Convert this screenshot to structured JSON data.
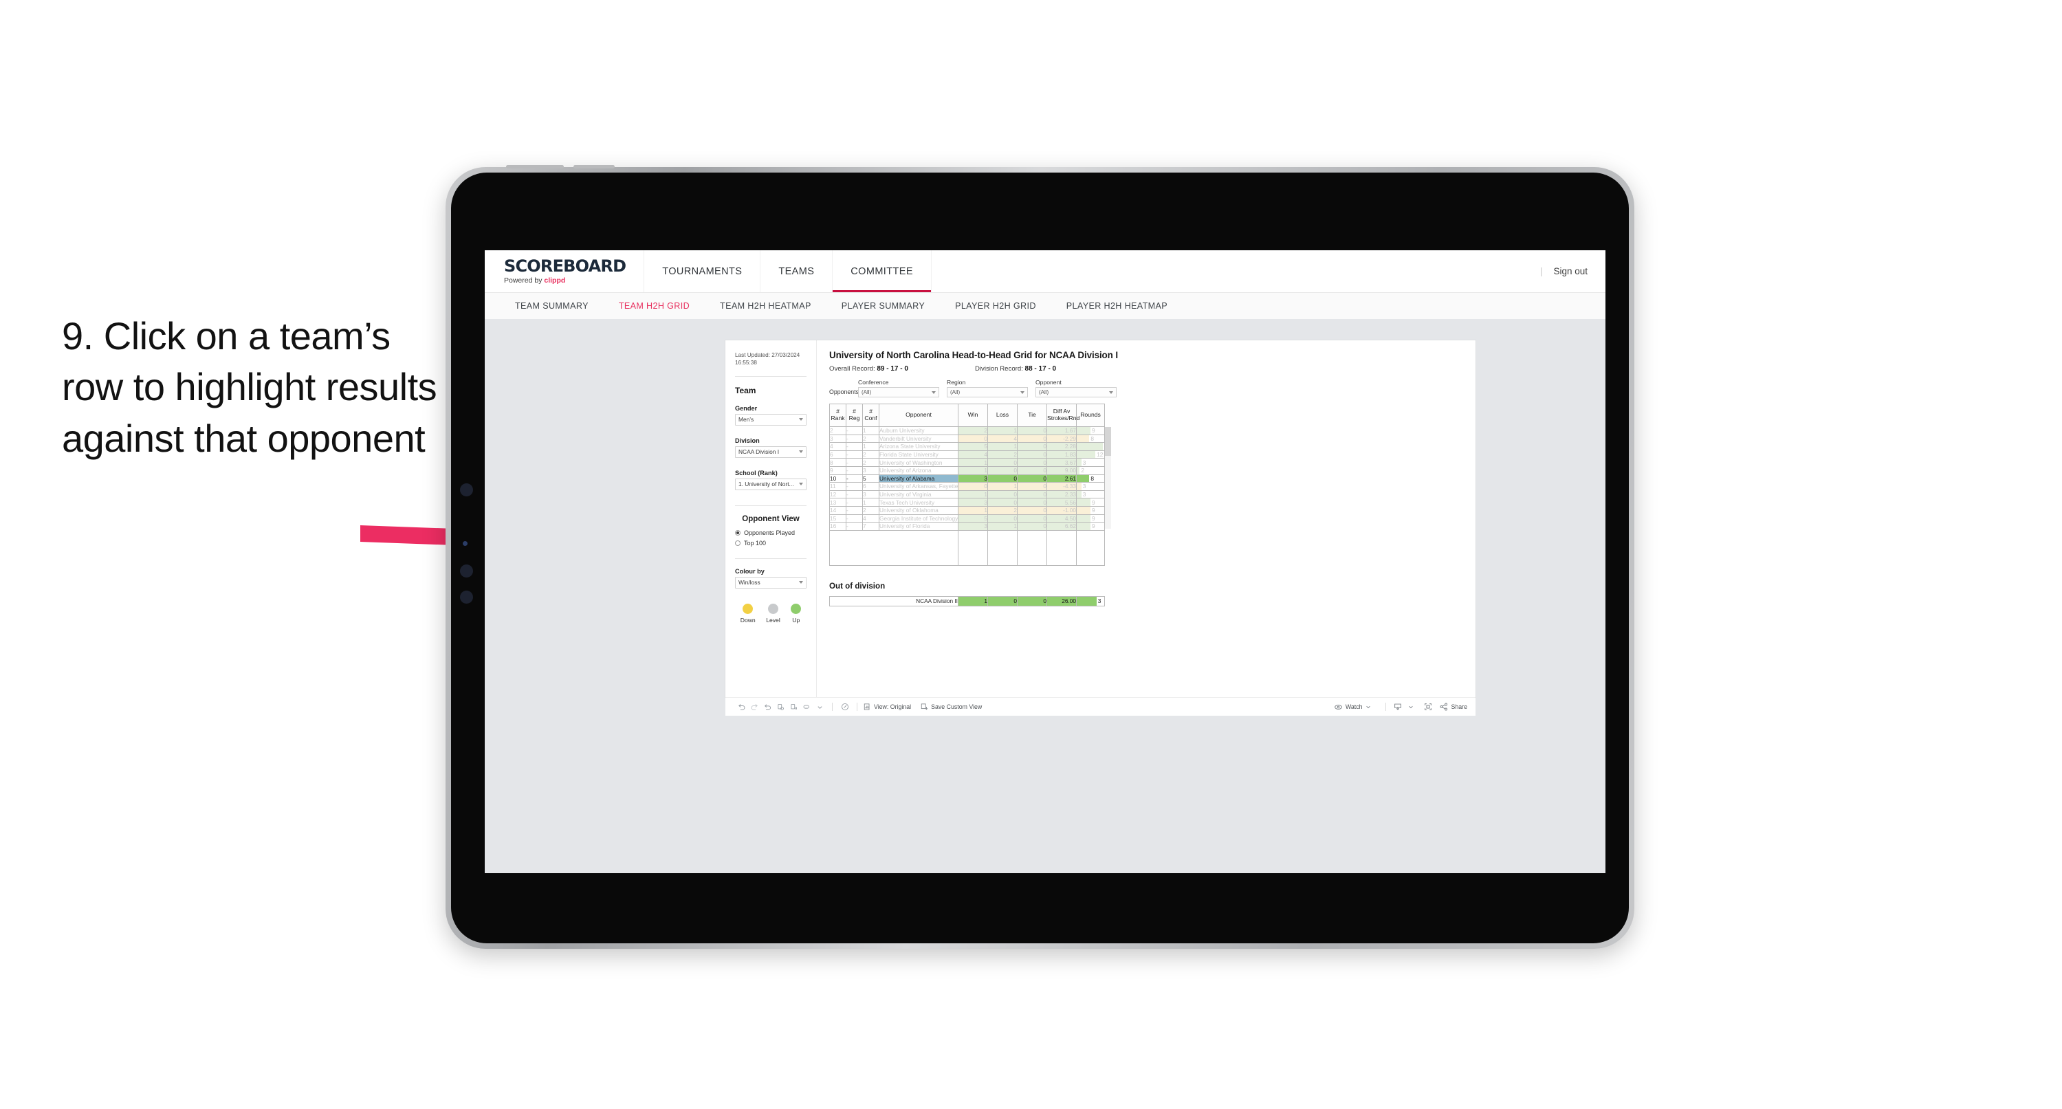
{
  "annotation": {
    "text": "9. Click on a team’s row to highlight results against that opponent"
  },
  "app": {
    "brand_title": "SCOREBOARD",
    "brand_sub_prefix": "Powered by ",
    "brand_sub_name": "clippd",
    "top_nav": [
      {
        "label": "TOURNAMENTS",
        "active": false
      },
      {
        "label": "TEAMS",
        "active": false
      },
      {
        "label": "COMMITTEE",
        "active": true
      }
    ],
    "sign_out": "Sign out",
    "divider": "|",
    "sub_nav": [
      {
        "label": "TEAM SUMMARY",
        "active": false
      },
      {
        "label": "TEAM H2H GRID",
        "active": true
      },
      {
        "label": "TEAM H2H HEATMAP",
        "active": false
      },
      {
        "label": "PLAYER SUMMARY",
        "active": false
      },
      {
        "label": "PLAYER H2H GRID",
        "active": false
      },
      {
        "label": "PLAYER H2H HEATMAP",
        "active": false
      }
    ],
    "accent_color": "#e8315f",
    "active_underline_color": "#c8103f"
  },
  "sidebar": {
    "last_updated_label": "Last Updated: 27/03/2024",
    "last_updated_time": "16:55:38",
    "team_heading": "Team",
    "gender_label": "Gender",
    "gender_value": "Men’s",
    "division_label": "Division",
    "division_value": "NCAA Division I",
    "school_label": "School (Rank)",
    "school_value": "1. University of Nort...",
    "opponent_view_heading": "Opponent View",
    "opponent_view_options": [
      {
        "label": "Opponents Played",
        "selected": true
      },
      {
        "label": "Top 100",
        "selected": false
      }
    ],
    "colour_by_label": "Colour by",
    "colour_by_value": "Win/loss",
    "legend": [
      {
        "label": "Down",
        "color": "#f2d044"
      },
      {
        "label": "Level",
        "color": "#c8cacc"
      },
      {
        "label": "Up",
        "color": "#8fcd6c"
      }
    ]
  },
  "viz": {
    "title": "University of North Carolina Head-to-Head Grid for NCAA Division I",
    "overall_record_label": "Overall Record:",
    "overall_record_value": "89 - 17 - 0",
    "division_record_label": "Division Record:",
    "division_record_value": "88 - 17 - 0",
    "filters_label": "Opponents:",
    "filters": [
      {
        "name": "Conference",
        "value": "(All)"
      },
      {
        "name": "Region",
        "value": "(All)"
      },
      {
        "name": "Opponent",
        "value": "(All)"
      }
    ],
    "out_of_division_title": "Out of division",
    "out_of_division_row": {
      "label": "NCAA Division II",
      "win": "1",
      "loss": "0",
      "tie": "0",
      "diff": "26.00",
      "rounds": "3",
      "rounds_pct": 72
    }
  },
  "chart_data": {
    "type": "table",
    "title": "University of North Carolina Head-to-Head Grid for NCAA Division I",
    "columns": [
      "# Rank",
      "# Reg",
      "# Conf",
      "Opponent",
      "Win",
      "Loss",
      "Tie",
      "Diff Av Strokes/Rnd",
      "Rounds"
    ],
    "column_header_lines": [
      [
        "#",
        "Rank"
      ],
      [
        "#",
        "Reg"
      ],
      [
        "#",
        "Conf"
      ],
      [
        "",
        "Opponent"
      ],
      [
        "",
        "Win"
      ],
      [
        "",
        "Loss"
      ],
      [
        "",
        "Tie"
      ],
      [
        "Diff Av",
        "Strokes/Rnd"
      ],
      [
        "",
        "Rounds"
      ]
    ],
    "rows": [
      {
        "rank": "2",
        "reg": "-",
        "conf": "1",
        "opponent": "Auburn University",
        "win": "2",
        "loss": "1",
        "tie": "0",
        "diff": "1.67",
        "rounds": "9",
        "rounds_pct": 50,
        "state": "up",
        "highlight": false
      },
      {
        "rank": "3",
        "reg": "-",
        "conf": "2",
        "opponent": "Vanderbilt University",
        "win": "0",
        "loss": "4",
        "tie": "0",
        "diff": "-2.29",
        "rounds": "8",
        "rounds_pct": 46,
        "state": "down",
        "highlight": false
      },
      {
        "rank": "4",
        "reg": "-",
        "conf": "1",
        "opponent": "Arizona State University",
        "win": "5",
        "loss": "1",
        "tie": "0",
        "diff": "2.28",
        "rounds": "17",
        "rounds_pct": 96,
        "state": "up",
        "highlight": false
      },
      {
        "rank": "6",
        "reg": "-",
        "conf": "2",
        "opponent": "Florida State University",
        "win": "4",
        "loss": "2",
        "tie": "0",
        "diff": "1.83",
        "rounds": "12",
        "rounds_pct": 68,
        "state": "up",
        "highlight": false
      },
      {
        "rank": "8",
        "reg": "-",
        "conf": "2",
        "opponent": "University of Washington",
        "win": "1",
        "loss": "0",
        "tie": "0",
        "diff": "3.67",
        "rounds": "3",
        "rounds_pct": 17,
        "state": "up",
        "highlight": false
      },
      {
        "rank": "9",
        "reg": "-",
        "conf": "3",
        "opponent": "University of Arizona",
        "win": "1",
        "loss": "0",
        "tie": "0",
        "diff": "9.00",
        "rounds": "2",
        "rounds_pct": 11,
        "state": "up",
        "highlight": false
      },
      {
        "rank": "10",
        "reg": "-",
        "conf": "5",
        "opponent": "University of Alabama",
        "win": "3",
        "loss": "0",
        "tie": "0",
        "diff": "2.61",
        "rounds": "8",
        "rounds_pct": 46,
        "state": "up",
        "highlight": true
      },
      {
        "rank": "11",
        "reg": "-",
        "conf": "6",
        "opponent": "University of Arkansas, Fayetteville",
        "win": "0",
        "loss": "1",
        "tie": "0",
        "diff": "-4.33",
        "rounds": "3",
        "rounds_pct": 17,
        "state": "down",
        "highlight": false
      },
      {
        "rank": "12",
        "reg": "-",
        "conf": "3",
        "opponent": "University of Virginia",
        "win": "1",
        "loss": "0",
        "tie": "0",
        "diff": "2.33",
        "rounds": "3",
        "rounds_pct": 17,
        "state": "up",
        "highlight": false
      },
      {
        "rank": "13",
        "reg": "-",
        "conf": "1",
        "opponent": "Texas Tech University",
        "win": "3",
        "loss": "0",
        "tie": "0",
        "diff": "5.56",
        "rounds": "9",
        "rounds_pct": 50,
        "state": "up",
        "highlight": false
      },
      {
        "rank": "14",
        "reg": "-",
        "conf": "2",
        "opponent": "University of Oklahoma",
        "win": "1",
        "loss": "2",
        "tie": "0",
        "diff": "-1.00",
        "rounds": "9",
        "rounds_pct": 50,
        "state": "down",
        "highlight": false
      },
      {
        "rank": "15",
        "reg": "-",
        "conf": "4",
        "opponent": "Georgia Institute of Technology",
        "win": "5",
        "loss": "0",
        "tie": "0",
        "diff": "4.50",
        "rounds": "9",
        "rounds_pct": 50,
        "state": "up",
        "highlight": false
      },
      {
        "rank": "16",
        "reg": "-",
        "conf": "7",
        "opponent": "University of Florida",
        "win": "3",
        "loss": "1",
        "tie": "0",
        "diff": "6.62",
        "rounds": "9",
        "rounds_pct": 50,
        "state": "up",
        "highlight": false
      }
    ],
    "colors": {
      "up_fill": "#e4efdd",
      "down_fill": "#faf0d8",
      "highlight_row_fill": "#8fcd6c",
      "highlight_opponent_fill": "#8fbbd1",
      "rounds_bar_up": "#e4efdd",
      "rounds_bar_down": "#faf0d8"
    },
    "legend": [
      "Down",
      "Level",
      "Up"
    ]
  },
  "toolbar": {
    "icons": [
      "undo-icon",
      "redo-icon",
      "revert-icon",
      "refresh-icon",
      "pause-icon",
      "device-layout-icon",
      "chevron-down-icon",
      "alerts-icon"
    ],
    "view_original_label": "View: Original",
    "save_custom_view_label": "Save Custom View",
    "watch_label": "Watch",
    "share_label": "Share"
  }
}
